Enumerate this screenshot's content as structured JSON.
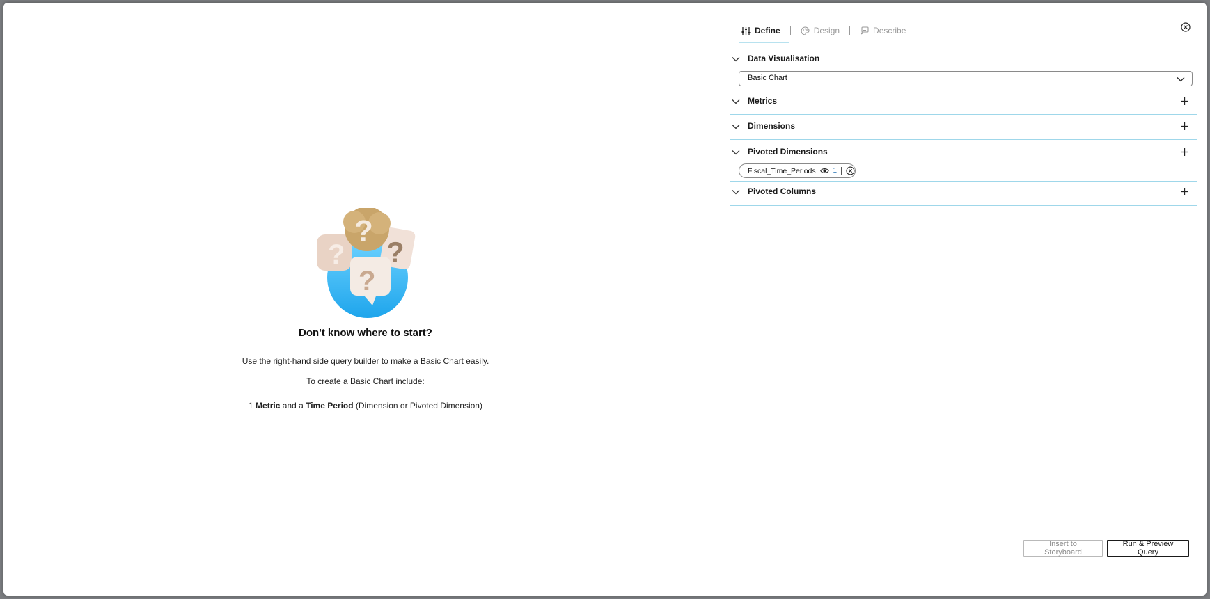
{
  "tabs": [
    {
      "label": "Define",
      "icon": "sliders-icon",
      "active": true
    },
    {
      "label": "Design",
      "icon": "palette-icon",
      "active": false
    },
    {
      "label": "Describe",
      "icon": "describe-icon",
      "active": false
    }
  ],
  "sections": {
    "data_visualisation": {
      "title": "Data Visualisation",
      "selected": "Basic Chart"
    },
    "metrics": {
      "title": "Metrics"
    },
    "dimensions": {
      "title": "Dimensions"
    },
    "pivoted_dimensions": {
      "title": "Pivoted Dimensions",
      "chip": {
        "label": "Fiscal_Time_Periods",
        "count": "1"
      }
    },
    "pivoted_columns": {
      "title": "Pivoted Columns"
    }
  },
  "empty_state": {
    "title": "Don't know where to start?",
    "line1": "Use the right-hand side query builder to make a Basic Chart easily.",
    "line2": "To create a Basic Chart include:",
    "line3_prefix": "1 ",
    "line3_metric": "Metric",
    "line3_mid": " and a ",
    "line3_time": "Time Period",
    "line3_suffix": " (Dimension or Pivoted Dimension)"
  },
  "footer": {
    "insert_label": "Insert to Storyboard",
    "run_label": "Run & Preview Query"
  },
  "colors": {
    "accent_line": "#9fd7ea",
    "globe_blue": "#29b6f6",
    "chip_count": "#1f6fb2"
  }
}
